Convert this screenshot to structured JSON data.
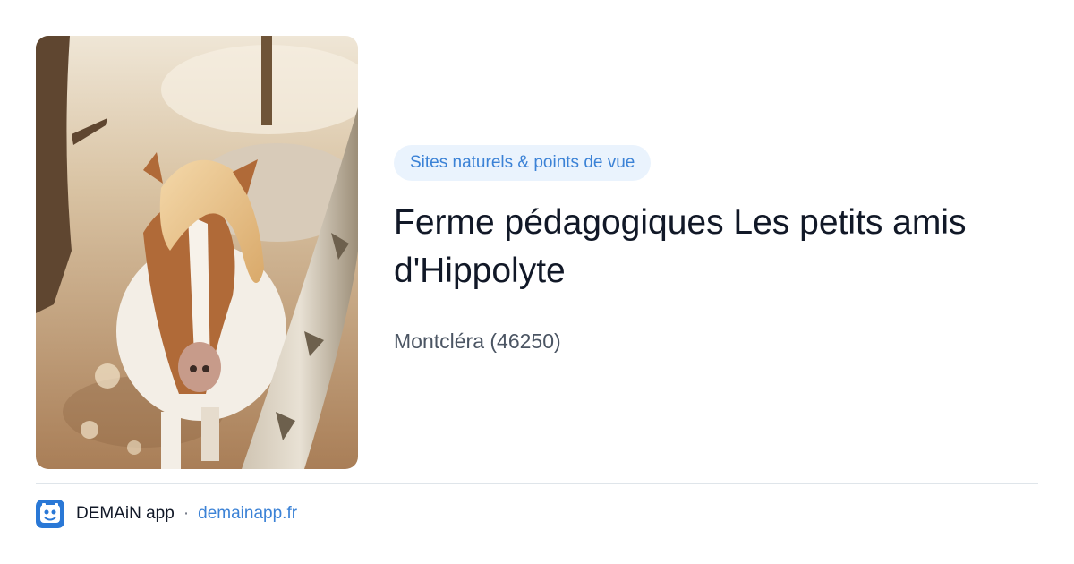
{
  "card": {
    "category": "Sites naturels & points de vue",
    "title": "Ferme pédagogiques Les petits amis d'Hippolyte",
    "location": "Montcléra (46250)"
  },
  "footer": {
    "app_name": "DEMAiN app",
    "separator": "·",
    "domain": "demainapp.fr"
  },
  "icons": {
    "app_icon": "demain-app-icon"
  },
  "colors": {
    "accent": "#3b82d6",
    "badge_bg": "#eaf3fd",
    "title": "#111827",
    "muted": "#4b5563"
  }
}
